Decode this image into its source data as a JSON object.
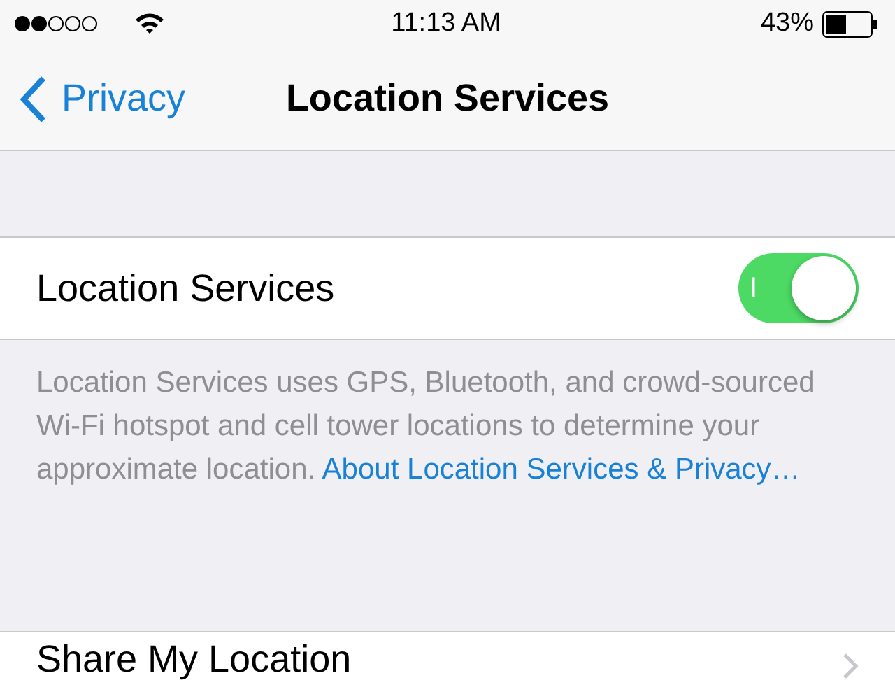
{
  "status_bar": {
    "time": "11:13 AM",
    "battery": "43%"
  },
  "nav_bar": {
    "back": "Privacy",
    "title": "Location Services"
  },
  "rows": [
    {
      "kind": "toggle",
      "label": "Location Services",
      "on": true,
      "on_label": "I"
    }
  ],
  "footer": {
    "text": "Location Services uses GPS, Bluetooth, and crowd-sourced Wi-Fi hotspot and cell tower locations to determine your approximate location.",
    "link": "About Location Services & Privacy…"
  },
  "rows_2": [
    {
      "kind": "disclosure",
      "label": "Share My Location"
    }
  ]
}
